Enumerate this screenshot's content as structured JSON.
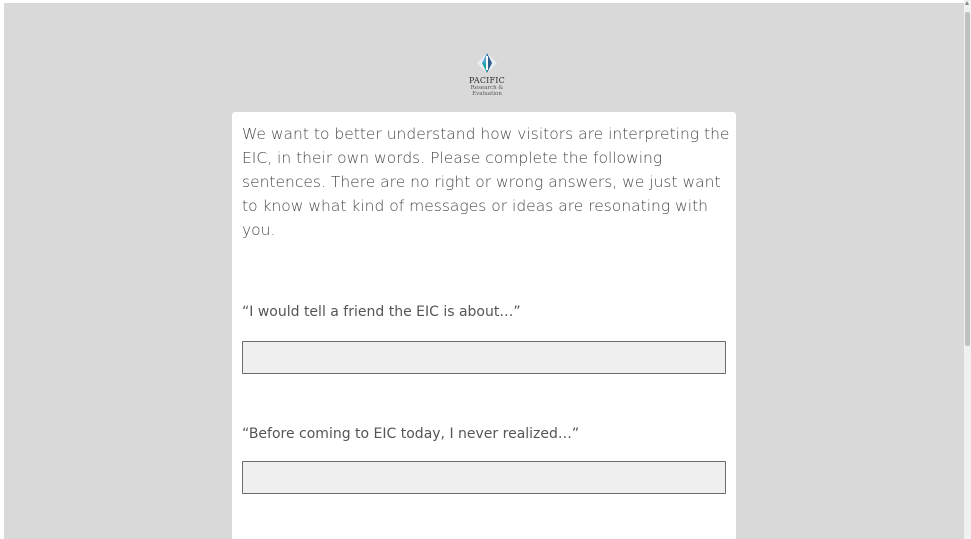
{
  "logo": {
    "name": "PACIFIC",
    "line1": "Research &",
    "line2": "Evaluation",
    "colors": {
      "dark_blue": "#2f5f8f",
      "light_blue": "#4fa6d6",
      "teal": "#1aa6a0"
    }
  },
  "survey": {
    "intro": "We want to better understand how visitors are interpreting the EIC, in their own words. Please complete the following sentences. There are no right or wrong answers, we just want to know what kind of messages or ideas are resonating with you.",
    "questions": [
      {
        "label": "“I would tell a friend the EIC is about…”",
        "value": ""
      },
      {
        "label": "“Before coming to EIC today, I never realized…”",
        "value": ""
      }
    ]
  },
  "colors": {
    "page_background": "#d9d9d9",
    "card_background": "#ffffff",
    "input_background": "#efefef",
    "input_border": "#6b6b6b"
  }
}
